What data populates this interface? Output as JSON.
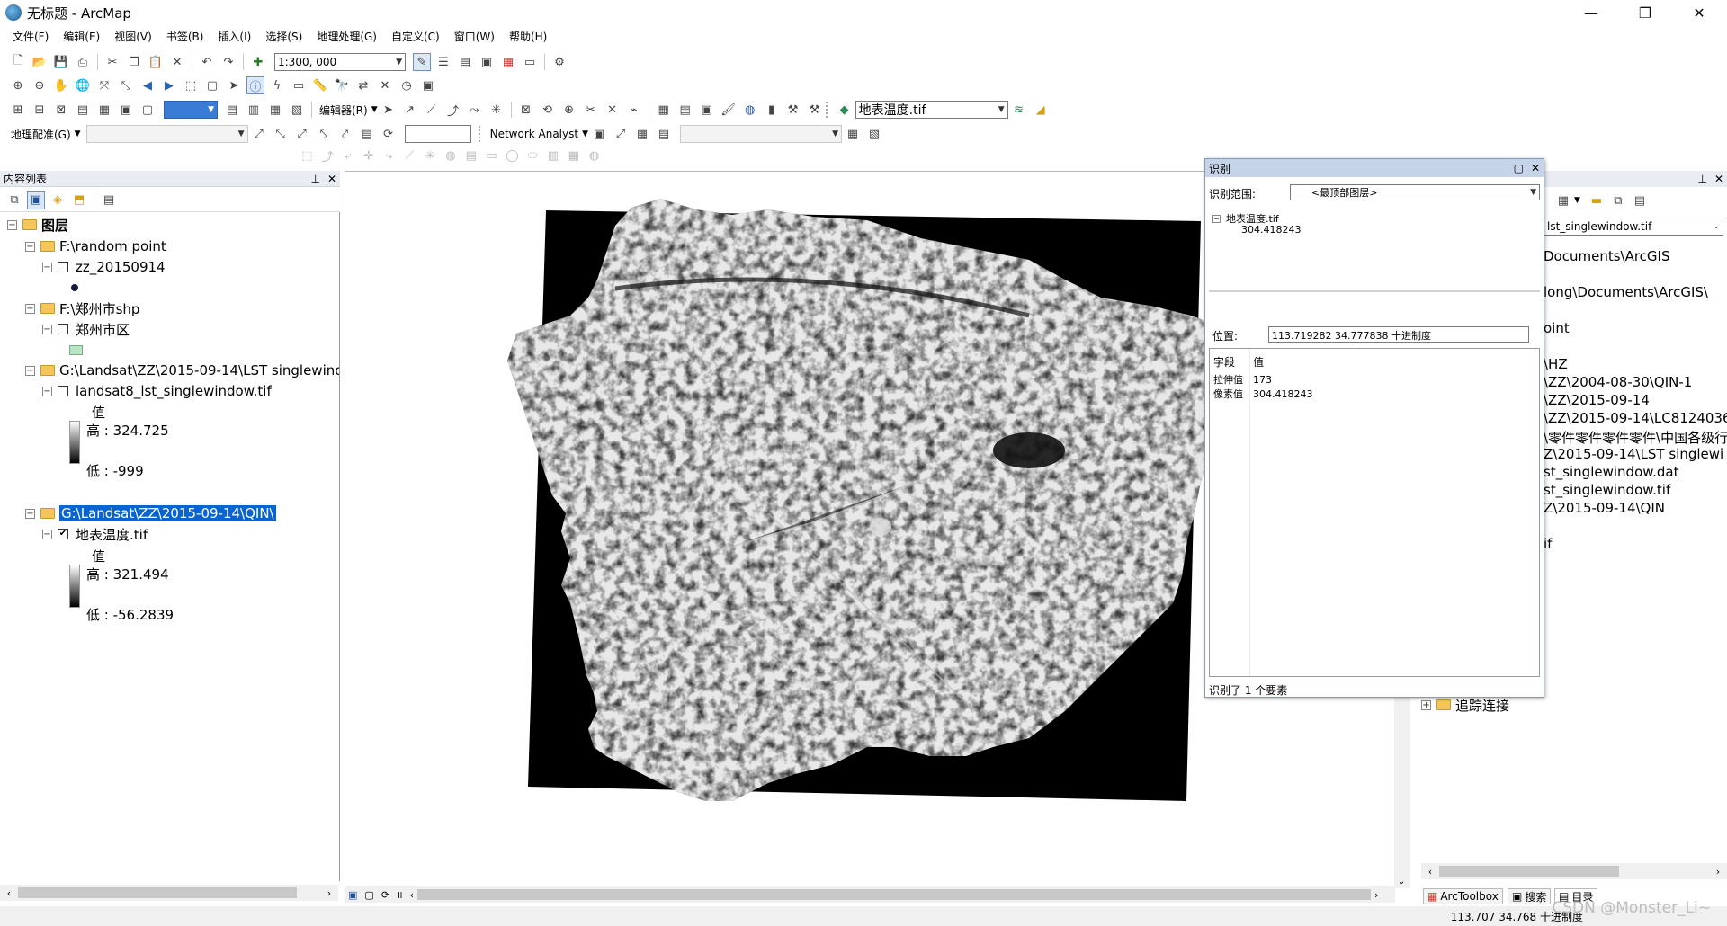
{
  "window": {
    "title": "无标题 - ArcMap",
    "minimize": "—",
    "restore": "❐",
    "close": "✕"
  },
  "menu": [
    "文件(F)",
    "编辑(E)",
    "视图(V)",
    "书签(B)",
    "插入(I)",
    "选择(S)",
    "地理处理(G)",
    "自定义(C)",
    "窗口(W)",
    "帮助(H)"
  ],
  "toolbar": {
    "scale_value": "1:300, 000",
    "editor_label": "编辑器(R)",
    "layer_select_value": "地表温度.tif",
    "georef_label": "地理配准(G)",
    "network_analyst_label": "Network Analyst"
  },
  "toc": {
    "title": "内容列表",
    "root_label": "图层",
    "groups": [
      {
        "label": "F:\\random point",
        "layer": "zz_20150914"
      },
      {
        "label": "F:\\郑州市shp",
        "layer": "郑州市区"
      },
      {
        "label": "G:\\Landsat\\ZZ\\2015-09-14\\LST singlewindo",
        "layer": "landsat8_lst_singlewindow.tif",
        "legend_title": "值",
        "high": "高 : 324.725",
        "low": "低 : -999"
      },
      {
        "label": "G:\\Landsat\\ZZ\\2015-09-14\\QIN\\",
        "layer": "地表温度.tif",
        "legend_title": "值",
        "high": "高 : 321.494",
        "low": "低 : -56.2839"
      }
    ]
  },
  "identify": {
    "title": "识别",
    "scope_label": "识别范围:",
    "scope_value": "<最顶部图层>",
    "tree_layer": "地表温度.tif",
    "tree_value": "304.418243",
    "location_label": "位置:",
    "location_value": "113.719282  34.777838 十进制度",
    "col_field": "字段",
    "col_value": "值",
    "rows": [
      {
        "field": "拉伸值",
        "value": "173"
      },
      {
        "field": "像素值",
        "value": "304.418243"
      }
    ],
    "status": "识别了 1 个要素"
  },
  "catalog": {
    "combo_value": "lst_singlewindow.tif",
    "lines": [
      "Documents\\ArcGIS",
      "long\\Documents\\ArcGIS\\",
      "oint",
      "\\HZ",
      "\\ZZ\\2004-08-30\\QIN-1",
      "\\ZZ\\2015-09-14",
      "\\ZZ\\2015-09-14\\LC8124036",
      "\\零件零件零件零件\\中国各级行",
      "Z\\2015-09-14\\LST singlewi",
      "st_singlewindow.dat",
      "st_singlewindow.tif",
      "Z\\2015-09-14\\QIN",
      "if"
    ],
    "tracking": "追踪连接"
  },
  "bottom_tabs": {
    "arctoolbox": "ArcToolbox",
    "search": "搜索",
    "catalog": "目录"
  },
  "status": {
    "coords": "113.707  34.768 十进制度"
  },
  "watermark": "CSDN @Monster_Li~"
}
